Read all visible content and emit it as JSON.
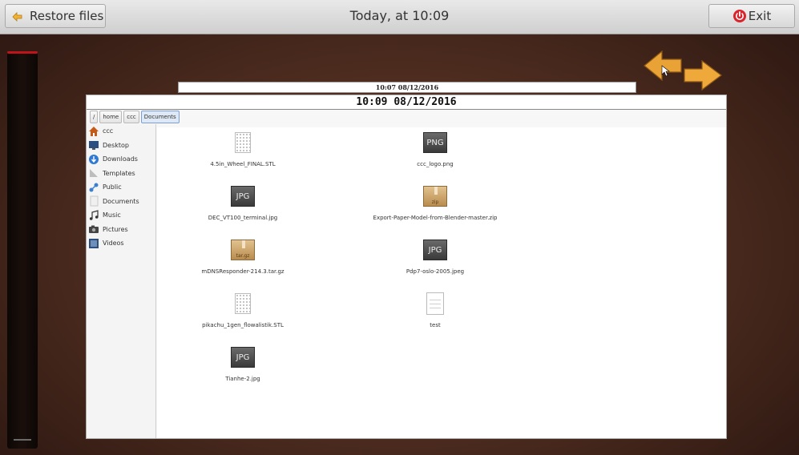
{
  "topbar": {
    "restore_label": "Restore files",
    "title": "Today, at 10:09",
    "exit_label": "Exit",
    "exit_color": "#d9242d"
  },
  "timeline": {
    "marker_color": "#c0141a"
  },
  "back_snapshot": {
    "title": "10:07 08/12/2016"
  },
  "window": {
    "title": "10:09 08/12/2016",
    "pathbar": [
      "/",
      "home",
      "ccc",
      "Documents"
    ],
    "sidebar": [
      {
        "label": "ccc",
        "icon": "home-icon"
      },
      {
        "label": "Desktop",
        "icon": "desktop-icon"
      },
      {
        "label": "Downloads",
        "icon": "downloads-icon"
      },
      {
        "label": "Templates",
        "icon": "templates-icon"
      },
      {
        "label": "Public",
        "icon": "public-icon"
      },
      {
        "label": "Documents",
        "icon": "documents-icon"
      },
      {
        "label": "Music",
        "icon": "music-icon"
      },
      {
        "label": "Pictures",
        "icon": "pictures-icon"
      },
      {
        "label": "Videos",
        "icon": "videos-icon"
      }
    ],
    "files": [
      {
        "name": "4.5in_Wheel_FINAL.STL",
        "icon": "stl-file-icon"
      },
      {
        "name": "ccc_logo.png",
        "icon": "image-file-icon",
        "badge": "PNG"
      },
      {
        "name": "DEC_VT100_terminal.jpg",
        "icon": "image-file-icon",
        "badge": "JPG"
      },
      {
        "name": "Export-Paper-Model-from-Blender-master.zip",
        "icon": "archive-file-icon",
        "badge": "zip"
      },
      {
        "name": "mDNSResponder-214.3.tar.gz",
        "icon": "archive-file-icon",
        "badge": "tar.gz"
      },
      {
        "name": "Pdp7-oslo-2005.jpeg",
        "icon": "image-file-icon",
        "badge": "JPG"
      },
      {
        "name": "pikachu_1gen_flowalistik.STL",
        "icon": "stl-file-icon"
      },
      {
        "name": "test",
        "icon": "text-file-icon"
      },
      {
        "name": "Tianhe-2.jpg",
        "icon": "image-file-icon",
        "badge": "JPG"
      }
    ]
  }
}
